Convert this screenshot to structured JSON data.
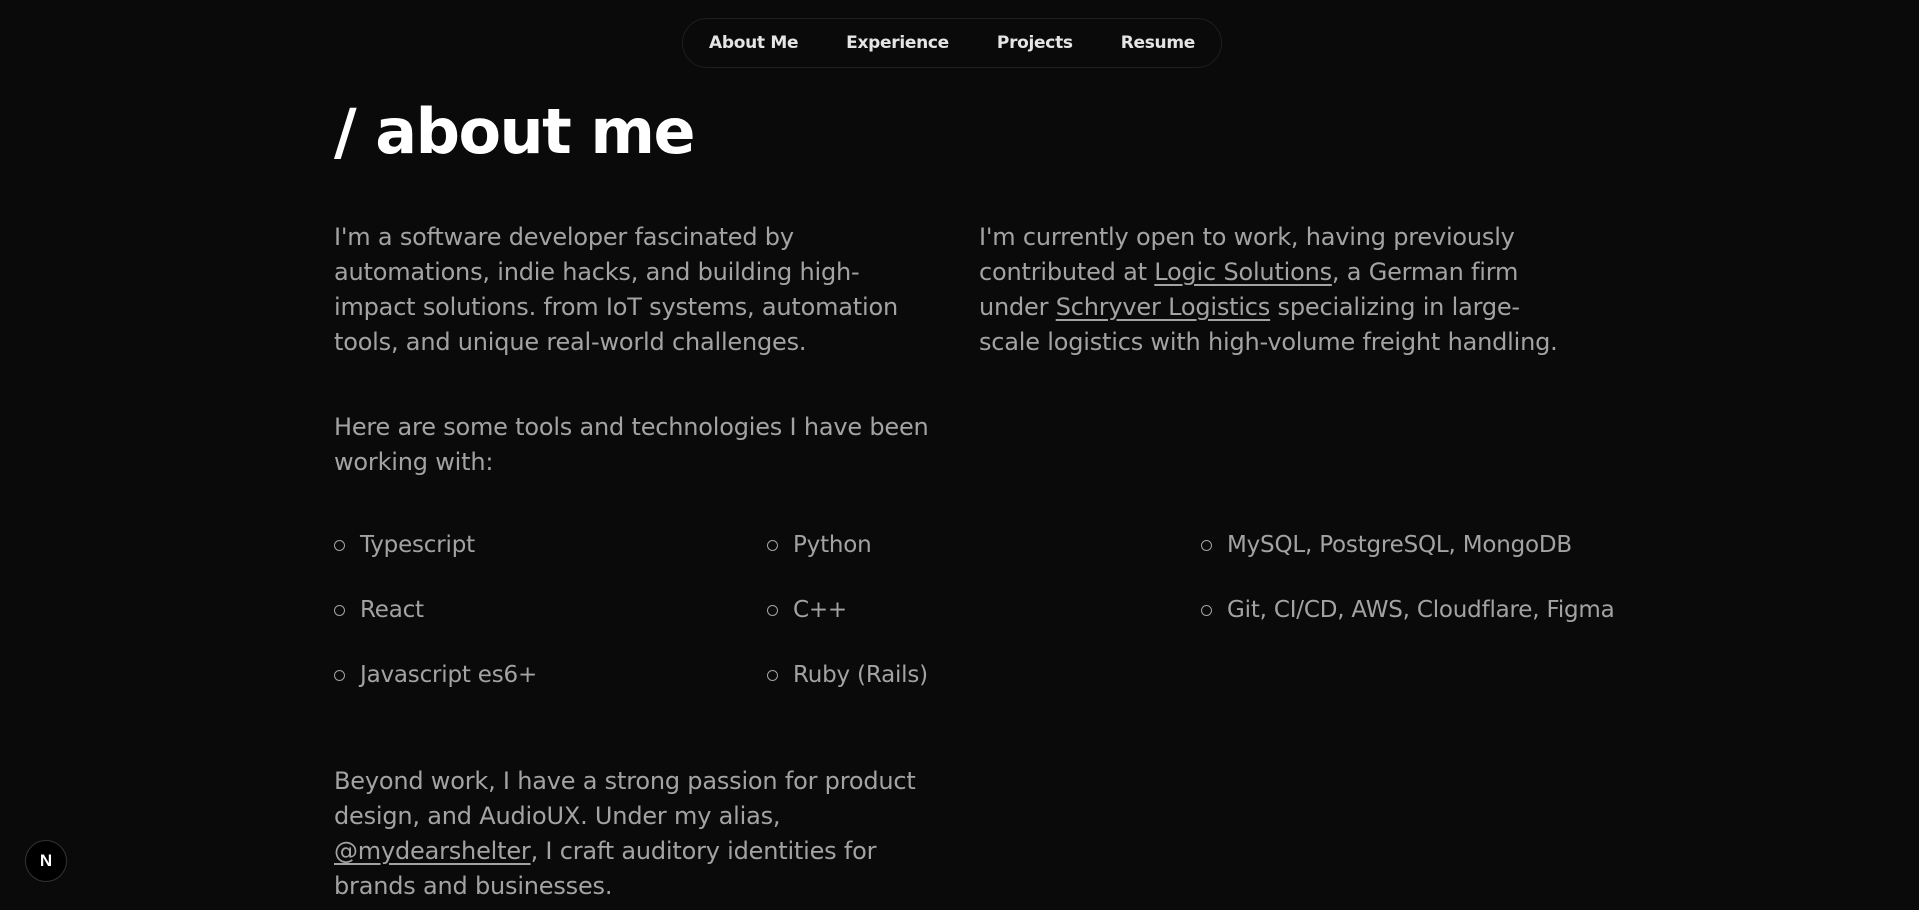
{
  "nav": {
    "items": [
      {
        "label": "About Me"
      },
      {
        "label": "Experience"
      },
      {
        "label": "Projects"
      },
      {
        "label": "Resume"
      }
    ]
  },
  "page": {
    "title": "/ about me"
  },
  "intro": {
    "left": "I'm a software developer fascinated by automations, indie hacks, and building high-impact solutions. from IoT systems, automation tools, and unique real-world challenges.",
    "right_before_link1": "I'm currently open to work, having previously contributed at ",
    "link1": "Logic Solutions",
    "right_between": ", a German firm under ",
    "link2": "Schryver Logistics",
    "right_after": " specializing in large-scale logistics with high-volume freight handling."
  },
  "tools": {
    "intro": "Here are some tools and technologies I have been working with:",
    "items": [
      {
        "label": "Typescript"
      },
      {
        "label": "React"
      },
      {
        "label": "Javascript es6+"
      },
      {
        "label": "Python"
      },
      {
        "label": "C++"
      },
      {
        "label": "Ruby (Rails)"
      },
      {
        "label": "MySQL, PostgreSQL, MongoDB"
      },
      {
        "label": "Git, CI/CD, AWS, Cloudflare, Figma"
      }
    ]
  },
  "beyond": {
    "before_link": "Beyond work, I have a strong passion for product design, and AudioUX. Under my alias, ",
    "link": "@mydearshelter",
    "after_link": ", I craft auditory identities for brands and businesses."
  },
  "badge": {
    "letter": "N"
  },
  "colors": {
    "background": "#0a0a0a",
    "text": "#a3a3a3",
    "heading": "#ffffff"
  }
}
